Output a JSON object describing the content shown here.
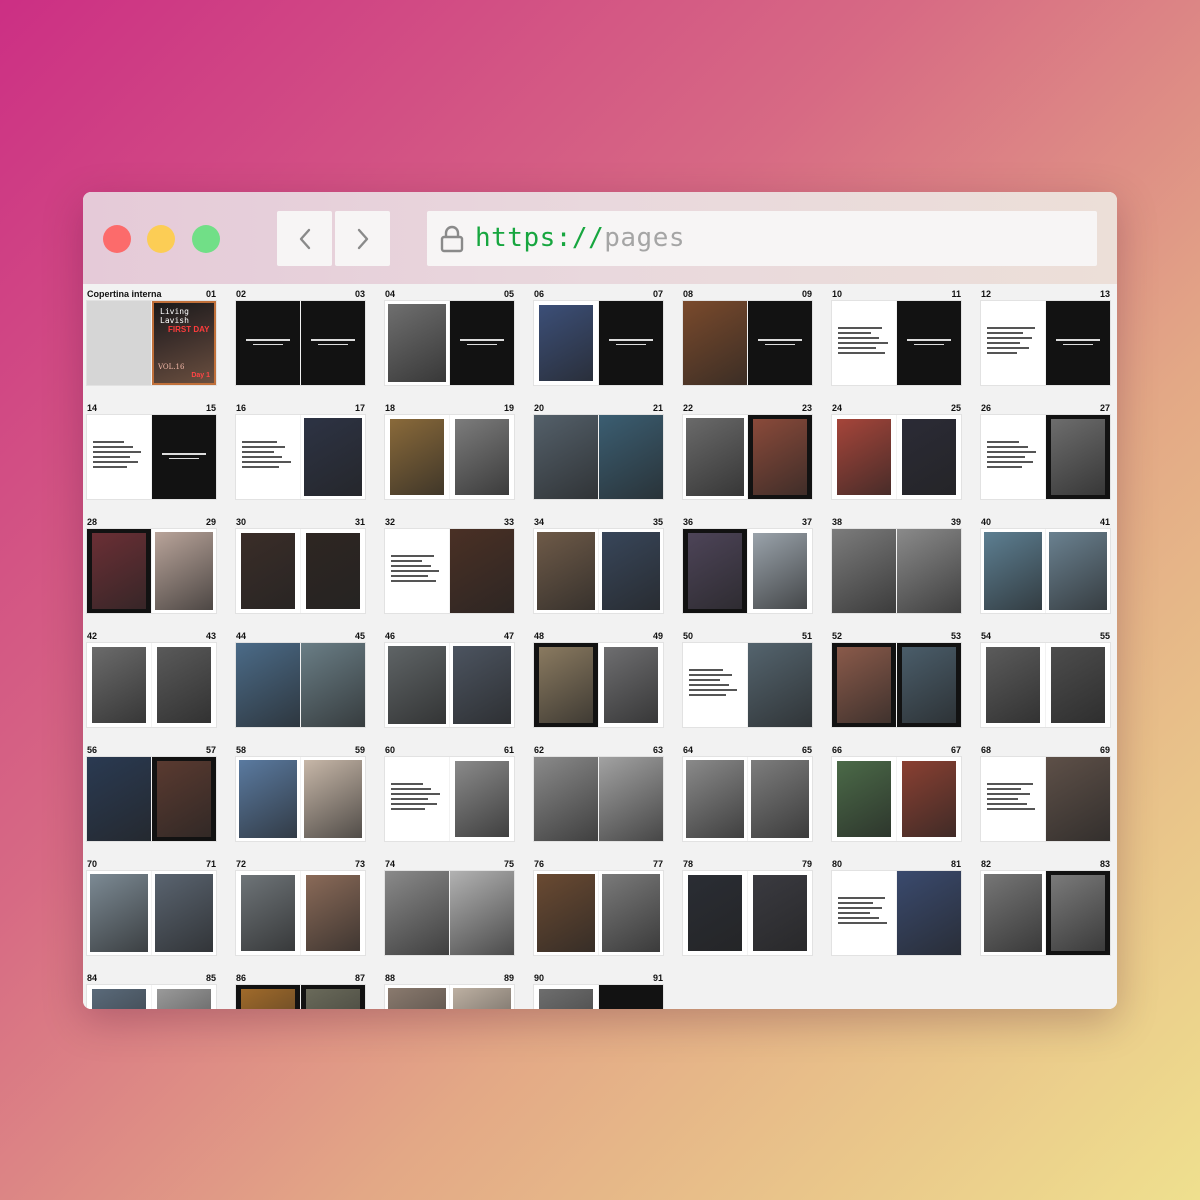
{
  "browser": {
    "url_protocol": "https://",
    "url_path": "pages"
  },
  "cover": {
    "label": "Copertina interna",
    "page": "01",
    "title": "Living Lavish",
    "red_text": "FIRST DAY",
    "bottom_text": "VOL.16",
    "day_text": "Day 1"
  },
  "spreads": [
    {
      "l": "02",
      "r": "03",
      "lt": "k",
      "rt": "k",
      "lc": "",
      "rc": ""
    },
    {
      "l": "04",
      "r": "05",
      "lt": "w",
      "rt": "k",
      "lc": "#6f6f6f",
      "rc": ""
    },
    {
      "l": "06",
      "r": "07",
      "lt": "w",
      "rt": "k",
      "lc": "#3c4f78",
      "rc": ""
    },
    {
      "l": "08",
      "r": "09",
      "lt": "w",
      "rt": "k",
      "lc": "#7a4a2c",
      "rc": ""
    },
    {
      "l": "10",
      "r": "11",
      "lt": "w",
      "rt": "k",
      "lc": "",
      "rc": ""
    },
    {
      "l": "12",
      "r": "13",
      "lt": "w",
      "rt": "k",
      "lc": "",
      "rc": ""
    },
    {
      "l": "14",
      "r": "15",
      "lt": "w",
      "rt": "k",
      "lc": "",
      "rc": ""
    },
    {
      "l": "16",
      "r": "17",
      "lt": "w",
      "rt": "w",
      "lc": "",
      "rc": "#2d3344"
    },
    {
      "l": "18",
      "r": "19",
      "lt": "w",
      "rt": "w",
      "lc": "#8a6a3a",
      "rc": "#7c7c7c"
    },
    {
      "l": "20",
      "r": "21",
      "lt": "w",
      "rt": "w",
      "lc": "#54606a",
      "rc": "#3b5e72"
    },
    {
      "l": "22",
      "r": "23",
      "lt": "w",
      "rt": "k",
      "lc": "#6a6a6a",
      "rc": "#8a4a3a"
    },
    {
      "l": "24",
      "r": "25",
      "lt": "w",
      "rt": "w",
      "lc": "#a6453a",
      "rc": "#2b2b36"
    },
    {
      "l": "26",
      "r": "27",
      "lt": "w",
      "rt": "k",
      "lc": "",
      "rc": "#6d6d6d"
    },
    {
      "l": "28",
      "r": "29",
      "lt": "k",
      "rt": "w",
      "lc": "#6b2f35",
      "rc": "#b9a49a"
    },
    {
      "l": "30",
      "r": "31",
      "lt": "w",
      "rt": "w",
      "lc": "#3a2d28",
      "rc": "#2e2622"
    },
    {
      "l": "32",
      "r": "33",
      "lt": "w",
      "rt": "w",
      "lc": "",
      "rc": "#4a3025"
    },
    {
      "l": "34",
      "r": "35",
      "lt": "w",
      "rt": "w",
      "lc": "#6e5a48",
      "rc": "#38465a"
    },
    {
      "l": "36",
      "r": "37",
      "lt": "k",
      "rt": "w",
      "lc": "#4d4458",
      "rc": "#9aa3ab"
    },
    {
      "l": "38",
      "r": "39",
      "lt": "w",
      "rt": "w",
      "lc": "#7c7c7c",
      "rc": "#8a8a8a"
    },
    {
      "l": "40",
      "r": "41",
      "lt": "w",
      "rt": "w",
      "lc": "#5d7f92",
      "rc": "#6a8190"
    },
    {
      "l": "42",
      "r": "43",
      "lt": "w",
      "rt": "w",
      "lc": "#6b6b6b",
      "rc": "#5a5a5a"
    },
    {
      "l": "44",
      "r": "45",
      "lt": "w",
      "rt": "w",
      "lc": "#4b6b88",
      "rc": "#6a7e86"
    },
    {
      "l": "46",
      "r": "47",
      "lt": "w",
      "rt": "w",
      "lc": "#5f6466",
      "rc": "#4c5460"
    },
    {
      "l": "48",
      "r": "49",
      "lt": "k",
      "rt": "w",
      "lc": "#8a7a60",
      "rc": "#6e6e70"
    },
    {
      "l": "50",
      "r": "51",
      "lt": "w",
      "rt": "w",
      "lc": "",
      "rc": "#54646e"
    },
    {
      "l": "52",
      "r": "53",
      "lt": "k",
      "rt": "k",
      "lc": "#8a5a4a",
      "rc": "#4a5d6a"
    },
    {
      "l": "54",
      "r": "55",
      "lt": "w",
      "rt": "w",
      "lc": "#5b5b5b",
      "rc": "#4d4d4d"
    },
    {
      "l": "56",
      "r": "57",
      "lt": "w",
      "rt": "k",
      "lc": "#2a3a52",
      "rc": "#5a3a30"
    },
    {
      "l": "58",
      "r": "59",
      "lt": "w",
      "rt": "w",
      "lc": "#5a7aa0",
      "rc": "#c7b7a8"
    },
    {
      "l": "60",
      "r": "61",
      "lt": "w",
      "rt": "w",
      "lc": "",
      "rc": "#8a8a8a"
    },
    {
      "l": "62",
      "r": "63",
      "lt": "w",
      "rt": "w",
      "lc": "#8a8a8a",
      "rc": "#a2a2a2"
    },
    {
      "l": "64",
      "r": "65",
      "lt": "w",
      "rt": "w",
      "lc": "#8a8a8a",
      "rc": "#7d7d7d"
    },
    {
      "l": "66",
      "r": "67",
      "lt": "w",
      "rt": "w",
      "lc": "#4b6a48",
      "rc": "#8a4032"
    },
    {
      "l": "68",
      "r": "69",
      "lt": "w",
      "rt": "w",
      "lc": "",
      "rc": "#5e5048"
    },
    {
      "l": "70",
      "r": "71",
      "lt": "w",
      "rt": "w",
      "lc": "#7c8a94",
      "rc": "#5a6470"
    },
    {
      "l": "72",
      "r": "73",
      "lt": "w",
      "rt": "w",
      "lc": "#6e7478",
      "rc": "#8a6a58"
    },
    {
      "l": "74",
      "r": "75",
      "lt": "w",
      "rt": "w",
      "lc": "#8a8a8a",
      "rc": "#b2b2b2"
    },
    {
      "l": "76",
      "r": "77",
      "lt": "w",
      "rt": "w",
      "lc": "#6a4a32",
      "rc": "#7a7a7a"
    },
    {
      "l": "78",
      "r": "79",
      "lt": "w",
      "rt": "w",
      "lc": "#2a2d34",
      "rc": "#3a3a40"
    },
    {
      "l": "80",
      "r": "81",
      "lt": "w",
      "rt": "w",
      "lc": "",
      "rc": "#3a4a6e"
    },
    {
      "l": "82",
      "r": "83",
      "lt": "w",
      "rt": "k",
      "lc": "#767676",
      "rc": "#7a7a7a"
    },
    {
      "l": "84",
      "r": "85",
      "lt": "w",
      "rt": "w",
      "lc": "#5a6a7a",
      "rc": "#9a9a9a"
    },
    {
      "l": "86",
      "r": "87",
      "lt": "k",
      "rt": "k",
      "lc": "#a06a2a",
      "rc": "#6a6a5a"
    },
    {
      "l": "88",
      "r": "89",
      "lt": "w",
      "rt": "w",
      "lc": "#8a7a6e",
      "rc": "#bdb0a2"
    },
    {
      "l": "90",
      "r": "91",
      "lt": "w",
      "rt": "k",
      "lc": "#6e6e6e",
      "rc": ""
    }
  ]
}
